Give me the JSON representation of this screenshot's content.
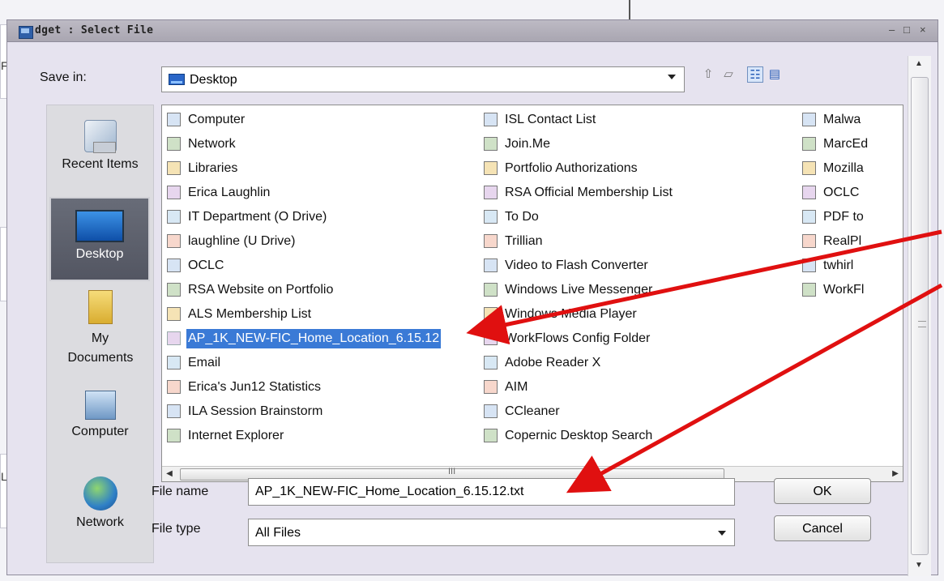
{
  "window": {
    "title": "dget : Select File",
    "controls": {
      "minimize": "–",
      "maximize": "□",
      "close": "×"
    }
  },
  "background": {
    "fragments": [
      "F",
      "L"
    ]
  },
  "save_in": {
    "label": "Save in:",
    "value": "Desktop",
    "icon": "desktop-icon"
  },
  "toolbar": {
    "icons": [
      "up-folder-icon",
      "new-folder-icon",
      "list-view-icon",
      "details-view-icon"
    ],
    "up_glyph": "⇧",
    "newfolder_glyph": "▱",
    "list_glyph": "☷",
    "details_glyph": "▤"
  },
  "places": [
    {
      "label": "Recent Items",
      "icon": "recent-items-icon"
    },
    {
      "label": "Desktop",
      "icon": "desktop-icon",
      "selected": true
    },
    {
      "label": "My Documents",
      "icon": "documents-icon"
    },
    {
      "label": "Computer",
      "icon": "computer-icon"
    },
    {
      "label": "Network",
      "icon": "network-icon"
    }
  ],
  "files": {
    "col1": [
      "Computer",
      "Network",
      "Libraries",
      "Erica Laughlin",
      "IT Department (O Drive)",
      "laughline (U Drive)",
      "OCLC",
      "RSA Website on Portfolio",
      "ALS Membership List",
      "AP_1K_NEW-FIC_Home_Location_6.15.12",
      "Email",
      "Erica's Jun12 Statistics",
      "ILA Session Brainstorm",
      "Internet Explorer"
    ],
    "col2": [
      "ISL Contact List",
      "Join.Me",
      "Portfolio Authorizations",
      "RSA Official Membership List",
      "To Do",
      "Trillian",
      "Video to Flash Converter",
      "Windows Live Messenger",
      "Windows Media Player",
      "WorkFlows Config Folder",
      "Adobe Reader X",
      "AIM",
      "CCleaner",
      "Copernic Desktop Search"
    ],
    "col3": [
      "Malwa",
      "MarcEd",
      "Mozilla",
      "OCLC",
      "PDF to",
      "RealPl",
      "twhirl",
      "WorkFl"
    ],
    "selected": "AP_1K_NEW-FIC_Home_Location_6.15.12",
    "hscroll_grip": "III",
    "hscroll_left": "◀",
    "hscroll_right": "▶"
  },
  "file_name": {
    "label": "File name",
    "value": "AP_1K_NEW-FIC_Home_Location_6.15.12.txt"
  },
  "file_type": {
    "label": "File type",
    "value": "All Files"
  },
  "buttons": {
    "ok": "OK",
    "cancel": "Cancel"
  },
  "vscroll": {
    "up": "▲",
    "down": "▼"
  },
  "annotation": {
    "arrow_color": "#e01010"
  }
}
